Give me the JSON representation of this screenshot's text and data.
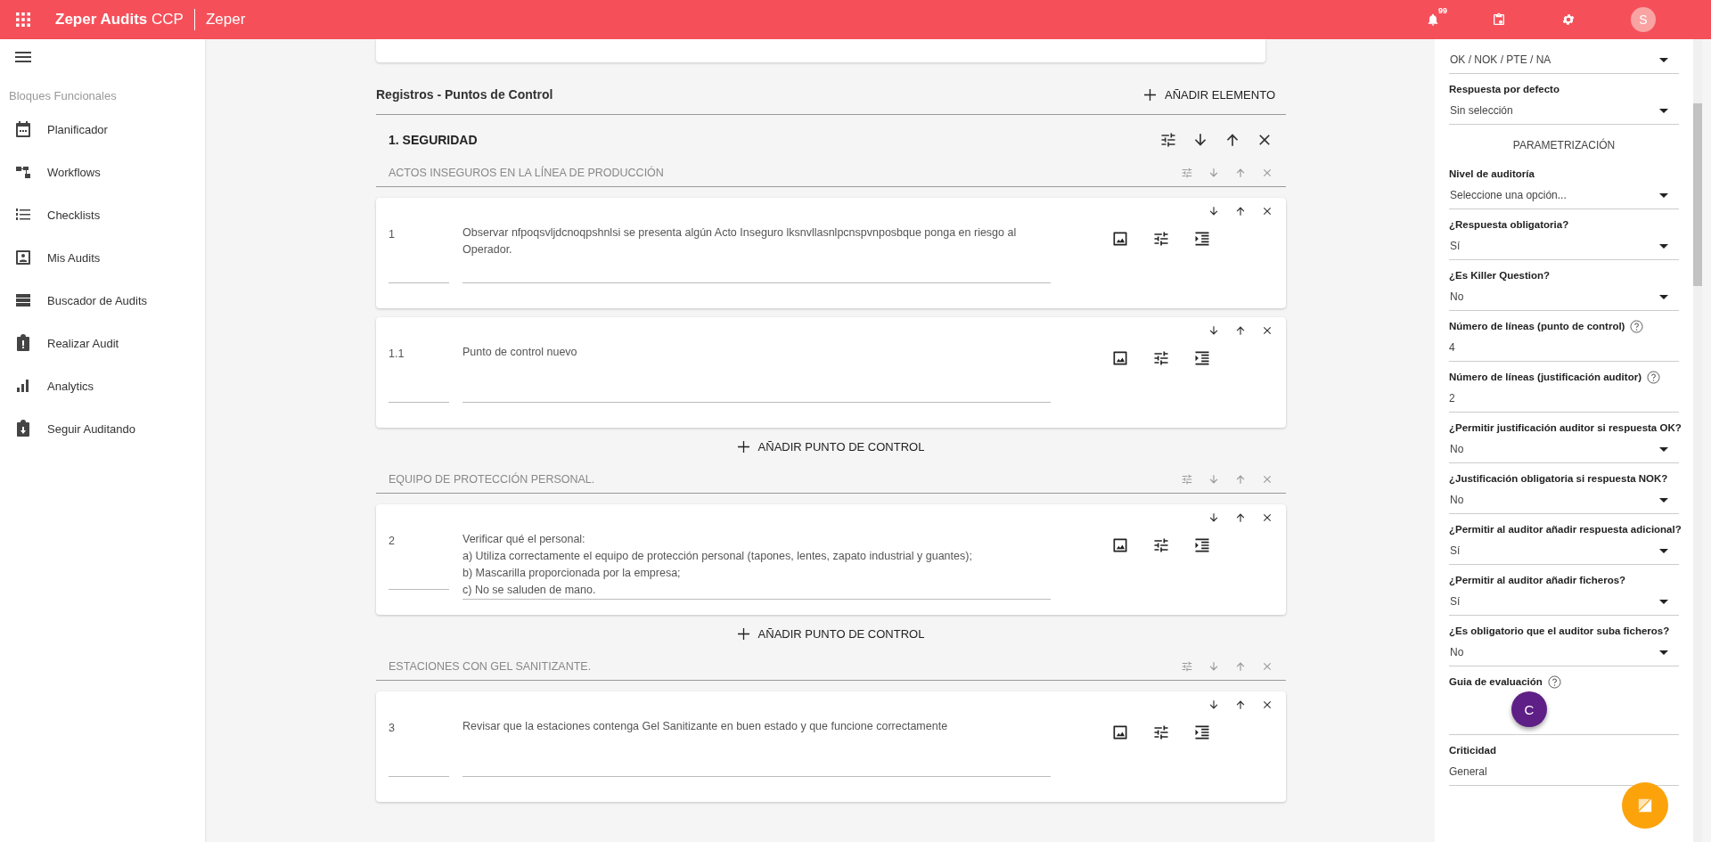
{
  "topbar": {
    "brand": "Zeper Audits",
    "brand_suffix": "CCP",
    "organization": "Zeper",
    "notification_count": "99",
    "avatar_initial": "S"
  },
  "sidebar": {
    "heading": "Bloques Funcionales",
    "items": [
      {
        "label": "Planificador",
        "kind": "calendar"
      },
      {
        "label": "Workflows",
        "kind": "workflow"
      },
      {
        "label": "Checklists",
        "kind": "list"
      },
      {
        "label": "Mis Audits",
        "kind": "person"
      },
      {
        "label": "Buscador de Audits",
        "kind": "table"
      },
      {
        "label": "Realizar Audit",
        "kind": "clipboard"
      },
      {
        "label": "Analytics",
        "kind": "chart"
      },
      {
        "label": "Seguir Auditando",
        "kind": "download"
      }
    ]
  },
  "main": {
    "title": "Registros - Puntos de Control",
    "add_element": "AÑADIR ELEMENTO",
    "sections": [
      {
        "title": "1. SEGURIDAD",
        "groups": [
          {
            "title": "ACTOS INSEGUROS EN LA LÍNEA DE PRODUCCIÓN",
            "add_label": "AÑADIR PUNTO DE CONTROL",
            "items": [
              {
                "number": "1",
                "text": "Observar nfpoqsvljdcnoqpshnlsi se presenta algún Acto Inseguro  lksnvllasnlpcnspvnposbque ponga en riesgo al  Operador."
              },
              {
                "number": "1.1",
                "text": "Punto de control nuevo"
              }
            ]
          },
          {
            "title": "EQUIPO DE PROTECCIÓN PERSONAL.",
            "add_label": "AÑADIR PUNTO DE CONTROL",
            "items": [
              {
                "number": "2",
                "text": "Verificar qué el personal:\na) Utiliza correctamente el equipo de protección personal (tapones, lentes, zapato industrial y guantes);\nb) Mascarilla proporcionada por la empresa;\nc) No se saluden de mano."
              }
            ]
          },
          {
            "title": "ESTACIONES CON GEL SANITIZANTE.",
            "items": [
              {
                "number": "3",
                "text": "Revisar que la estaciones contenga Gel Sanitizante en buen estado y que funcione correctamente"
              }
            ]
          }
        ]
      }
    ]
  },
  "panel": {
    "fields": [
      {
        "kind": "select",
        "value": "OK / NOK / PTE / NA"
      },
      {
        "kind": "select",
        "label": "Respuesta por defecto",
        "value": "Sin selección"
      },
      {
        "kind": "heading",
        "label": "PARAMETRIZACIÓN"
      },
      {
        "kind": "select",
        "label": "Nivel de auditoría",
        "value": "Seleccione una opción..."
      },
      {
        "kind": "select",
        "label": "¿Respuesta obligatoria?",
        "value": "Sí"
      },
      {
        "kind": "select",
        "label": "¿Es Killer Question?",
        "value": "No"
      },
      {
        "kind": "number",
        "label": "Número de líneas (punto de control)",
        "help": true,
        "value": "4"
      },
      {
        "kind": "number",
        "label": "Número de líneas (justificación auditor)",
        "help": true,
        "value": "2"
      },
      {
        "kind": "select",
        "label": "¿Permitir justificación auditor si respuesta OK?",
        "value": "No"
      },
      {
        "kind": "select",
        "label": "¿Justificación obligatoria si respuesta NOK?",
        "value": "No"
      },
      {
        "kind": "select",
        "label": "¿Permitir al auditor añadir respuesta adicional?",
        "value": "Sí"
      },
      {
        "kind": "select",
        "label": "¿Permitir al auditor añadir ficheros?",
        "value": "Sí"
      },
      {
        "kind": "select",
        "label": "¿Es obligatorio que el auditor suba ficheros?",
        "value": "No"
      },
      {
        "kind": "guide",
        "label": "Guia de evaluación",
        "help": true,
        "value": "C"
      },
      {
        "kind": "number",
        "label": "Criticidad",
        "value": "General"
      }
    ]
  }
}
